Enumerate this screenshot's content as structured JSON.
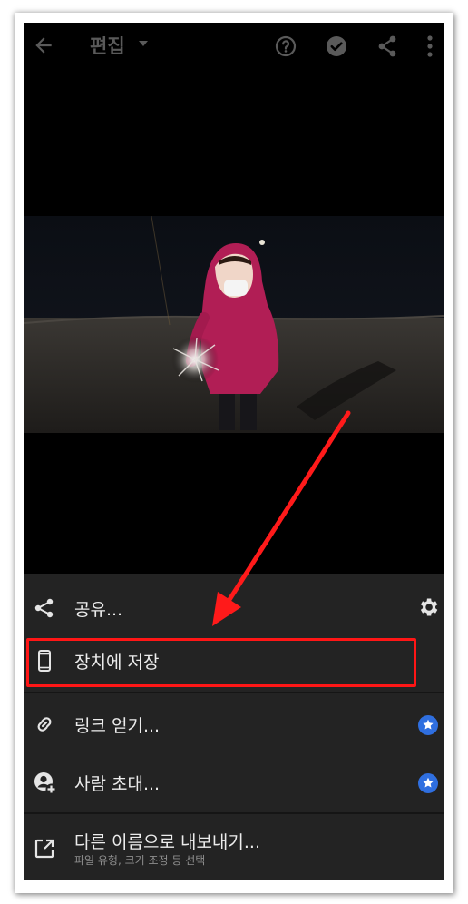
{
  "topbar": {
    "title": "편집",
    "icons": [
      "back-arrow-icon",
      "dropdown-caret-icon",
      "help-icon",
      "check-icon",
      "share-icon",
      "more-vert-icon"
    ]
  },
  "menu": {
    "share_label": "공유...",
    "save_device_label": "장치에 저장",
    "get_link_label": "링크 얻기...",
    "invite_label": "사람 초대...",
    "export_label": "다른 이름으로 내보내기...",
    "export_sub": "파일 유형, 크기 조정 등 선택"
  },
  "colors": {
    "highlight": "#ff1616",
    "annotation_arrow": "#ff1a1a",
    "badge": "#2f6fe0",
    "sheet_bg": "#232323"
  }
}
